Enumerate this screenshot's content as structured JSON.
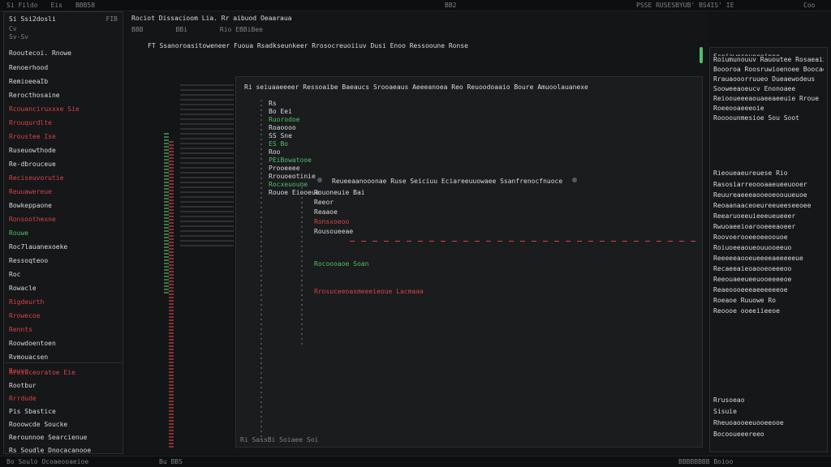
{
  "topbar": {
    "left_menu": [
      "Si Fildo",
      "Eis",
      "BBB58"
    ],
    "center_label": "BB2",
    "right_text": "PSSE RUSESBYUB' BS4IS' IE",
    "far_right": "Coo"
  },
  "left_panel": {
    "header": "Si Ssi2dosli",
    "header_badge": "FIB",
    "sub_header": "Cv",
    "sub2": "Sv-Sv",
    "section_title": "Rooutecoi. Rnowe",
    "items": [
      {
        "label": "Renoerhood",
        "color": "white"
      },
      {
        "label": "RemioeeaIb",
        "color": "white"
      },
      {
        "label": "Rerocthosaine",
        "color": "white"
      },
      {
        "label": "Rcouanciruxxxe Sie",
        "color": "red"
      },
      {
        "label": "Rrouqurdlte",
        "color": "red"
      },
      {
        "label": "Rroustee Ise",
        "color": "red"
      },
      {
        "label": "Ruseuowthode",
        "color": "white"
      },
      {
        "label": "Re-dbrouceue",
        "color": "white"
      },
      {
        "label": "Reciseuvorutie",
        "color": "red"
      },
      {
        "label": "Reuuawereue",
        "color": "red"
      },
      {
        "label": "Bowkeppaone",
        "color": "white"
      },
      {
        "label": "Ronsoothexne",
        "color": "red"
      },
      {
        "label": "Rouwe",
        "color": "green"
      },
      {
        "label": "Roc7lauanexoeke",
        "color": "white"
      },
      {
        "label": "Ressoqteoo",
        "color": "white"
      },
      {
        "label": "Roc",
        "color": "white"
      },
      {
        "label": "Rowacle",
        "color": "white"
      },
      {
        "label": "Rigdeurth",
        "color": "red"
      },
      {
        "label": "Rrowecoe",
        "color": "red"
      },
      {
        "label": "Rennts",
        "color": "red"
      },
      {
        "label": "Roowdoentoen",
        "color": "white"
      },
      {
        "label": "Rvmouacsen",
        "color": "white"
      },
      {
        "label": "Rouve",
        "color": "red"
      }
    ],
    "footer_items": [
      {
        "label": "Rrosuceoratoe Eie",
        "color": "red"
      },
      {
        "label": "Rootbur",
        "color": "white"
      },
      {
        "label": "Rrrdude",
        "color": "red"
      },
      {
        "label": "Pis Sbastice",
        "color": "white"
      },
      {
        "label": "Rooowcde Soucke",
        "color": "white"
      },
      {
        "label": "Rerounnoe Searcienue",
        "color": "white"
      },
      {
        "label": "Rs Soudle Dnocacanooe",
        "color": "white"
      }
    ]
  },
  "editor": {
    "tab_title": "Rociot Dissacioom Lia. Rr aibuod Oeaaraua",
    "breadcrumb": [
      "BBB",
      "BBi",
      "Rio EBBiBee"
    ],
    "header_line": "FT Ssanoroasitoweneer Fuoua Rsadkseunkeer Rrosocreuoiiuv Dusi Enoo Ressooune Ronse",
    "inner_header": "Ri seiuaaeeeer Ressoaibe Baeaucs Srooaeaus Aeeeanoea Reo Reuoodoaaio Boure Amuoolauanexe",
    "mid_line": "Reueeaanooonae Ruse Seiciuu Eciareeuuowaee Ssanfrenocfnuoce",
    "code_lines": [
      {
        "t": "Rs",
        "c": "white"
      },
      {
        "t": "Bo Eei",
        "c": "white"
      },
      {
        "t": "Ruorodoe",
        "c": "green"
      },
      {
        "t": "Roaoooo",
        "c": "white"
      },
      {
        "t": "SS Sne",
        "c": "white"
      },
      {
        "t": "ES Bo",
        "c": "green"
      },
      {
        "t": "Roo",
        "c": "white"
      },
      {
        "t": "PEiBowatooe",
        "c": "green"
      },
      {
        "t": "Prooeeee",
        "c": "white"
      },
      {
        "t": "Rrouoeotinie",
        "c": "white"
      },
      {
        "t": "Rocxeuouue",
        "c": "green"
      },
      {
        "t": "Rouoe Eiooeue",
        "c": "white"
      }
    ],
    "panel_lines": [
      {
        "t": "Rouoneuie Bai",
        "c": "white"
      },
      {
        "t": "Reeor",
        "c": "white"
      },
      {
        "t": "Reaaoe",
        "c": "white"
      },
      {
        "t": "Ronsxoeoo",
        "c": "red"
      },
      {
        "t": "Rousoueeae",
        "c": "white"
      }
    ],
    "search_line": "Rocoooaoe Soan",
    "error_line": "Rrosuceeoasmeeeieoue Lacmaaa",
    "footer": "Ri SassBi Soiaee Soi"
  },
  "right_panel": {
    "title": "Sceiawecoueeoinee",
    "lines": [
      "Roiumunouuv Rauoutee Rosaeaixoea",
      "Boooroa Roosruwioenoee Boocaeo",
      "Rrauaooorruueo Dueaewodeus",
      "Sooweeaoeucv Enonoaee",
      "Reiooueeeaouaeeaeeuie Rroue",
      "Roeeooaeeeoie",
      "Roooounmesioe Sou Soot"
    ],
    "section2": "Rieoueaeureuese Rio",
    "lines2": [
      "Rasosiarreoooaaeueeuooer",
      "Reuureaeeeaooeoeoouueuoe",
      "Reoaanaaceoeureeueeseeoee",
      "Reearuoeeuieeeueueeer",
      "Rwuoaeeioarooeeeaoeer",
      "Roovoerooeeoeeoouoe",
      "Roiuoeeaoueouuooeeuo",
      "Reeeeeaooeueeeeaeeeeeue",
      "Recaeeaieoaooeoeeeoo",
      "Reeouaeeueeuooeeeeoe",
      "Reaeoooeeeaeeeeeeoe",
      "Roeaoe Ruuowe Ro",
      "Reoooe ooeeiieeoe"
    ],
    "footer_lines": [
      "Rrusoeao",
      "Sisuie",
      "Rheuoaooeeuooeeooe",
      "Bocooueeereeo"
    ]
  },
  "statusbar": {
    "left": "Bo Soulo Ocoaeooaeioe",
    "center": "Bu BBS",
    "right": "BBBBBBBB Boioo"
  },
  "colors": {
    "bg": "#121314",
    "panel": "#191a1c",
    "accent_red": "#d5444b",
    "accent_green": "#4fbf6a"
  }
}
